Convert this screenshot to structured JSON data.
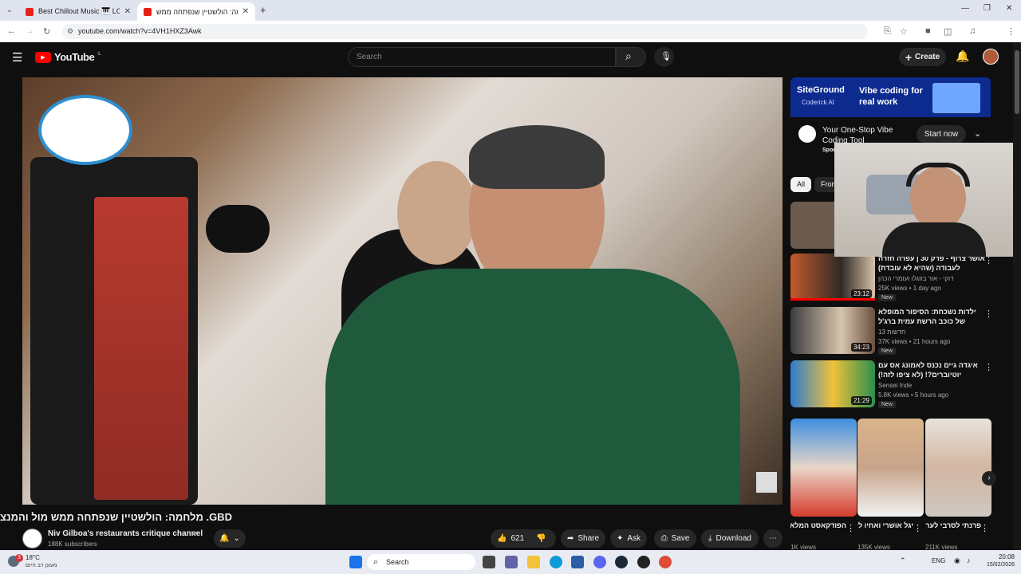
{
  "browser": {
    "tabs": [
      {
        "title": "Best Chillout Music 🎹 LOUNGE",
        "active": false
      },
      {
        "title": "מלחמה: הולשטיין שנפתחה ממש",
        "active": true
      }
    ],
    "url": "youtube.com/watch?v=4VH1HXZ3Awk"
  },
  "header": {
    "logo": "YouTube",
    "region": "IL",
    "search_placeholder": "Search",
    "create_label": "Create"
  },
  "video": {
    "title": "GBD. מלחמה: הולשטיין שנפתחה ממש מול והמנצח?",
    "channel": "Niv Gilboa's restaurants critique channel",
    "subscribers": "188K subscribers",
    "likes": "621",
    "share_label": "Share",
    "ask_label": "Ask",
    "save_label": "Save",
    "download_label": "Download"
  },
  "ad": {
    "brand": "SiteGround",
    "sub": "Coderick AI",
    "headline": "Vibe coding for real work",
    "title": "Your One-Stop Vibe Coding Tool",
    "sponsor": "Sponsored",
    "cta": "Start now"
  },
  "chips": [
    {
      "label": "All"
    },
    {
      "label": "From"
    }
  ],
  "recommendations": [
    {
      "title": "אושר צרוף - פרק 30 | עפרה חזרה לעבודה (שהיא לא עובדת)",
      "channel": "דוקי - אור בוזגלו ועומרי הכהן",
      "meta": "25K views • 1 day ago",
      "duration": "23:12",
      "badge": "New"
    },
    {
      "title": "ילדות נשכחת: הסיפור המופלא של כוכב הרשת עמית ברג'ל",
      "channel": "חדשות 13",
      "meta": "37K views • 21 hours ago",
      "duration": "34:23",
      "badge": "New"
    },
    {
      "title": "איגדה גיים נכנס לאמונג אס עם יוטיוברים?! (לא ציפו לזה!)",
      "channel": "Sensei Inde",
      "meta": "5.8K views • 5 hours ago",
      "duration": "21:29",
      "badge": "New"
    }
  ],
  "shorts": [
    {
      "title": "הפודקאסט המלא בתיאור",
      "views": "1K views"
    },
    {
      "title": "יגל אושרי ואחיו לירן אושרי",
      "views": "135K views"
    },
    {
      "title": "פרנתי לסרבי לערוץ בשביל",
      "views": "211K views"
    }
  ],
  "taskbar": {
    "weather_temp": "18°C",
    "weather_desc": "מעונן רב היום",
    "search_label": "Search",
    "lang": "ENG",
    "time": "20:08",
    "date": "15/02/2026",
    "notification_count": "3"
  },
  "colors": {
    "yt_red": "#ff0000",
    "bg": "#0f0f0f",
    "ad_blue": "#0d2a8f"
  }
}
